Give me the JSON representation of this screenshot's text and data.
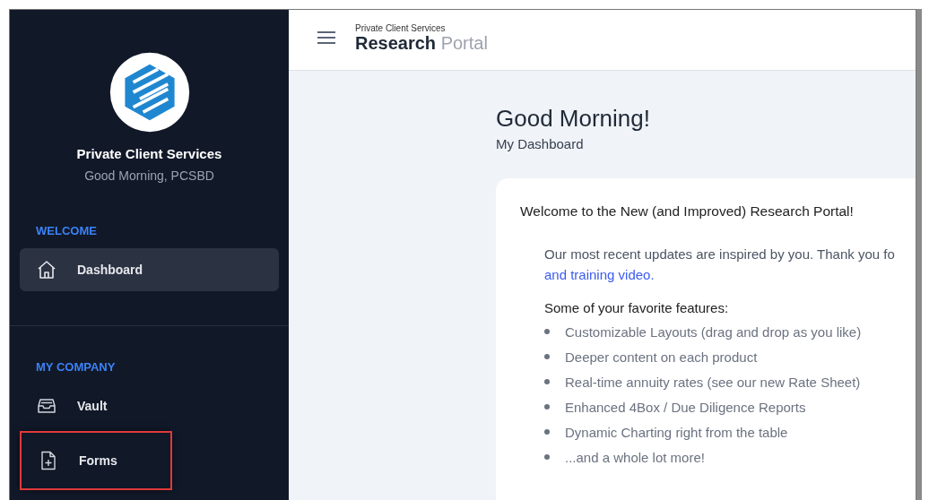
{
  "sidebar": {
    "title": "Private Client Services",
    "subtitle": "Good Morning, PCSBD",
    "sections": [
      {
        "heading": "WELCOME",
        "items": [
          {
            "label": "Dashboard",
            "kind": "home",
            "selected": true,
            "highlighted": false
          }
        ]
      },
      {
        "heading": "MY COMPANY",
        "items": [
          {
            "label": "Vault",
            "kind": "storage",
            "selected": false,
            "highlighted": false
          },
          {
            "label": "Forms",
            "kind": "form",
            "selected": false,
            "highlighted": true
          }
        ]
      }
    ]
  },
  "header": {
    "caption": "Private Client Services",
    "title": "Research",
    "title_light": "Portal"
  },
  "main": {
    "greeting": "Good Morning!",
    "subheading": "My Dashboard",
    "card": {
      "title": "Welcome to the New (and Improved) Research Portal!",
      "paragraph": "Our most recent updates are inspired by you. Thank you fo",
      "link": "and training video.",
      "features_heading": "Some of your favorite features:",
      "features": [
        "Customizable Layouts (drag and drop as you like)",
        "Deeper content on each product",
        "Real-time annuity rates (see our new Rate Sheet)",
        "Enhanced 4Box / Due Diligence Reports",
        "Dynamic Charting right from the table",
        "...and a whole lot more!"
      ]
    }
  }
}
